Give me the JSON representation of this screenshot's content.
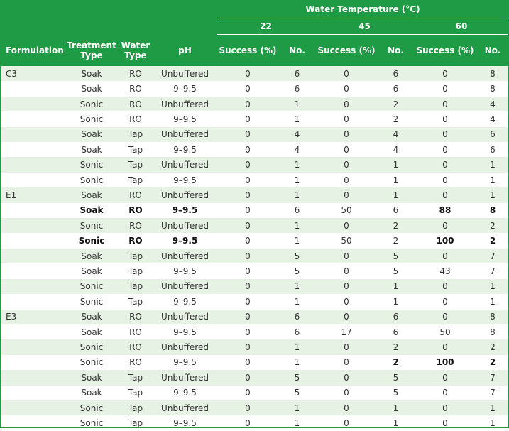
{
  "header": {
    "group_title": "Water Temperature (°C)",
    "temps": [
      "22",
      "45",
      "60"
    ],
    "formulation": "Formulation",
    "treatment_type": "Treatment Type",
    "water_type": "Water Type",
    "ph": "pH",
    "success": "Success (%)",
    "no": "No."
  },
  "rows": [
    {
      "f": "C3",
      "t": "Soak",
      "w": "RO",
      "p": "Unbuffered",
      "s22": "0",
      "n22": "6",
      "s45": "0",
      "n45": "6",
      "s60": "0",
      "n60": "8",
      "bold": []
    },
    {
      "f": "",
      "t": "Soak",
      "w": "RO",
      "p": "9–9.5",
      "s22": "0",
      "n22": "6",
      "s45": "0",
      "n45": "6",
      "s60": "0",
      "n60": "8",
      "bold": []
    },
    {
      "f": "",
      "t": "Sonic",
      "w": "RO",
      "p": "Unbuffered",
      "s22": "0",
      "n22": "1",
      "s45": "0",
      "n45": "2",
      "s60": "0",
      "n60": "4",
      "bold": []
    },
    {
      "f": "",
      "t": "Sonic",
      "w": "RO",
      "p": "9–9.5",
      "s22": "0",
      "n22": "1",
      "s45": "0",
      "n45": "2",
      "s60": "0",
      "n60": "4",
      "bold": []
    },
    {
      "f": "",
      "t": "Soak",
      "w": "Tap",
      "p": "Unbuffered",
      "s22": "0",
      "n22": "4",
      "s45": "0",
      "n45": "4",
      "s60": "0",
      "n60": "6",
      "bold": []
    },
    {
      "f": "",
      "t": "Soak",
      "w": "Tap",
      "p": "9–9.5",
      "s22": "0",
      "n22": "4",
      "s45": "0",
      "n45": "4",
      "s60": "0",
      "n60": "6",
      "bold": []
    },
    {
      "f": "",
      "t": "Sonic",
      "w": "Tap",
      "p": "Unbuffered",
      "s22": "0",
      "n22": "1",
      "s45": "0",
      "n45": "1",
      "s60": "0",
      "n60": "1",
      "bold": []
    },
    {
      "f": "",
      "t": "Sonic",
      "w": "Tap",
      "p": "9–9.5",
      "s22": "0",
      "n22": "1",
      "s45": "0",
      "n45": "1",
      "s60": "0",
      "n60": "1",
      "bold": []
    },
    {
      "f": "E1",
      "t": "Soak",
      "w": "RO",
      "p": "Unbuffered",
      "s22": "0",
      "n22": "1",
      "s45": "0",
      "n45": "1",
      "s60": "0",
      "n60": "1",
      "bold": []
    },
    {
      "f": "",
      "t": "Soak",
      "w": "RO",
      "p": "9–9.5",
      "s22": "0",
      "n22": "6",
      "s45": "50",
      "n45": "6",
      "s60": "88",
      "n60": "8",
      "bold": [
        "t",
        "w",
        "p",
        "s60",
        "n60"
      ]
    },
    {
      "f": "",
      "t": "Sonic",
      "w": "RO",
      "p": "Unbuffered",
      "s22": "0",
      "n22": "1",
      "s45": "0",
      "n45": "2",
      "s60": "0",
      "n60": "2",
      "bold": []
    },
    {
      "f": "",
      "t": "Sonic",
      "w": "RO",
      "p": "9–9.5",
      "s22": "0",
      "n22": "1",
      "s45": "50",
      "n45": "2",
      "s60": "100",
      "n60": "2",
      "bold": [
        "t",
        "w",
        "p",
        "s60",
        "n60"
      ]
    },
    {
      "f": "",
      "t": "Soak",
      "w": "Tap",
      "p": "Unbuffered",
      "s22": "0",
      "n22": "5",
      "s45": "0",
      "n45": "5",
      "s60": "0",
      "n60": "7",
      "bold": []
    },
    {
      "f": "",
      "t": "Soak",
      "w": "Tap",
      "p": "9–9.5",
      "s22": "0",
      "n22": "5",
      "s45": "0",
      "n45": "5",
      "s60": "43",
      "n60": "7",
      "bold": []
    },
    {
      "f": "",
      "t": "Sonic",
      "w": "Tap",
      "p": "Unbuffered",
      "s22": "0",
      "n22": "1",
      "s45": "0",
      "n45": "1",
      "s60": "0",
      "n60": "1",
      "bold": []
    },
    {
      "f": "",
      "t": "Sonic",
      "w": "Tap",
      "p": "9–9.5",
      "s22": "0",
      "n22": "1",
      "s45": "0",
      "n45": "1",
      "s60": "0",
      "n60": "1",
      "bold": []
    },
    {
      "f": "E3",
      "t": "Soak",
      "w": "RO",
      "p": "Unbuffered",
      "s22": "0",
      "n22": "6",
      "s45": "0",
      "n45": "6",
      "s60": "0",
      "n60": "8",
      "bold": []
    },
    {
      "f": "",
      "t": "Soak",
      "w": "RO",
      "p": "9–9.5",
      "s22": "0",
      "n22": "6",
      "s45": "17",
      "n45": "6",
      "s60": "50",
      "n60": "8",
      "bold": []
    },
    {
      "f": "",
      "t": "Sonic",
      "w": "RO",
      "p": "Unbuffered",
      "s22": "0",
      "n22": "1",
      "s45": "0",
      "n45": "2",
      "s60": "0",
      "n60": "2",
      "bold": []
    },
    {
      "f": "",
      "t": "Sonic",
      "w": "RO",
      "p": "9–9.5",
      "s22": "0",
      "n22": "1",
      "s45": "0",
      "n45": "2",
      "s60": "100",
      "n60": "2",
      "bold": [
        "n45",
        "s60",
        "n60"
      ]
    },
    {
      "f": "",
      "t": "Soak",
      "w": "Tap",
      "p": "Unbuffered",
      "s22": "0",
      "n22": "5",
      "s45": "0",
      "n45": "5",
      "s60": "0",
      "n60": "7",
      "bold": []
    },
    {
      "f": "",
      "t": "Soak",
      "w": "Tap",
      "p": "9–9.5",
      "s22": "0",
      "n22": "5",
      "s45": "0",
      "n45": "5",
      "s60": "0",
      "n60": "7",
      "bold": []
    },
    {
      "f": "",
      "t": "Sonic",
      "w": "Tap",
      "p": "Unbuffered",
      "s22": "0",
      "n22": "1",
      "s45": "0",
      "n45": "1",
      "s60": "0",
      "n60": "1",
      "bold": []
    },
    {
      "f": "",
      "t": "Sonic",
      "w": "Tap",
      "p": "9–9.5",
      "s22": "0",
      "n22": "1",
      "s45": "0",
      "n45": "1",
      "s60": "0",
      "n60": "1",
      "bold": []
    }
  ],
  "colors": {
    "header_bg": "#1f9a45",
    "stripe": "#e6f2e3",
    "text": "#333333"
  }
}
